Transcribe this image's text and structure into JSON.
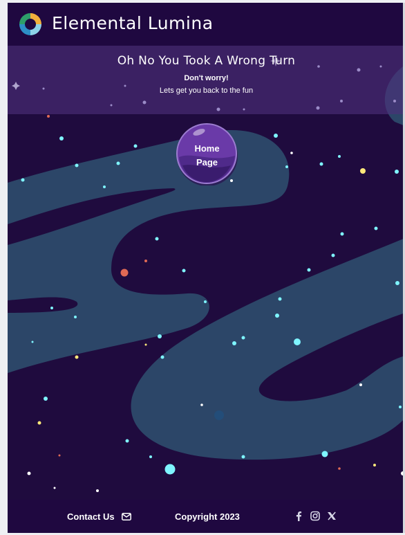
{
  "header": {
    "brand_name": "Elemental Lumina",
    "logo_icon": "swirl-logo-icon"
  },
  "banner": {
    "title": "Oh No You Took A Wrong Turn",
    "line1": "Don't worry!",
    "line2": "Lets get you back to the fun"
  },
  "home_button": {
    "line1": "Home",
    "line2": "Page"
  },
  "footer": {
    "contact_label": "Contact Us",
    "contact_icon": "envelope-icon",
    "copyright": "Copyright 2023",
    "socials": [
      "facebook-icon",
      "instagram-icon",
      "x-icon"
    ]
  },
  "colors": {
    "background": "#1f0b3e",
    "header": "#1f0840",
    "banner": "#4e2e7a",
    "river": "#2c4668",
    "planet": "#6a3aa8",
    "star_cyan": "#7ff5ff",
    "star_yellow": "#ffe97a",
    "star_red": "#e06a55"
  }
}
